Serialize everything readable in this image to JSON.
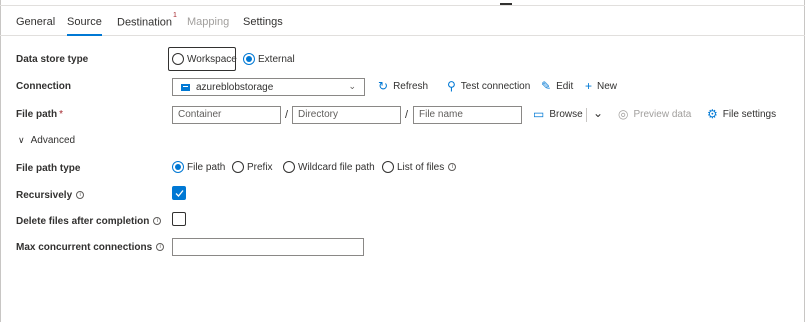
{
  "tabs": [
    {
      "label": "General",
      "state": "normal"
    },
    {
      "label": "Source",
      "state": "active"
    },
    {
      "label": "Destination",
      "state": "normal",
      "badge": "1"
    },
    {
      "label": "Mapping",
      "state": "disabled"
    },
    {
      "label": "Settings",
      "state": "normal"
    }
  ],
  "form": {
    "data_store_type": {
      "label": "Data store type",
      "options": [
        "Workspace",
        "External"
      ],
      "selected": "External"
    },
    "connection": {
      "label": "Connection",
      "value": "azureblobstorage",
      "refresh_label": "Refresh",
      "test_label": "Test connection",
      "edit_label": "Edit",
      "new_label": "New"
    },
    "file_path": {
      "label": "File path",
      "required_marker": "*",
      "container_placeholder": "Container",
      "directory_placeholder": "Directory",
      "filename_placeholder": "File name",
      "separator": "/",
      "browse_label": "Browse",
      "preview_label": "Preview data",
      "file_settings_label": "File settings"
    },
    "advanced": {
      "label": "Advanced",
      "expanded": true
    },
    "file_path_type": {
      "label": "File path type",
      "options": [
        "File path",
        "Prefix",
        "Wildcard file path",
        "List of files"
      ],
      "selected": "File path"
    },
    "recursively": {
      "label": "Recursively",
      "checked": true
    },
    "delete_files": {
      "label": "Delete files after completion",
      "checked": false
    },
    "max_concurrent": {
      "label": "Max concurrent connections",
      "value": ""
    }
  },
  "colors": {
    "accent": "#0078d4",
    "required": "#a4262c",
    "disabled": "#a19f9d"
  }
}
